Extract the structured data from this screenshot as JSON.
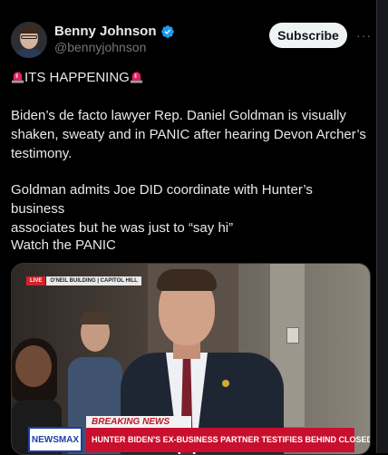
{
  "author": {
    "name": "Benny Johnson",
    "handle": "@bennyjohnson",
    "verified_color": "#1d9bf0"
  },
  "actions": {
    "subscribe_label": "Subscribe",
    "more_label": "···"
  },
  "post": {
    "headline": "ITS HAPPENING",
    "paragraph1_line1": "Biden’s de facto lawyer Rep. Daniel Goldman is visually",
    "paragraph1_line2": "shaken, sweaty and in PANIC after hearing Devon Archer’s",
    "paragraph1_line3": "testimony.",
    "paragraph2_line1": "Goldman admits Joe DID coordinate with Hunter’s business",
    "paragraph2_line2": "associates but he was just to “say hi”",
    "paragraph3": "Watch the PANIC"
  },
  "media": {
    "live_label": "LIVE",
    "location_label": "O'NEIL BUILDING | CAPITOL HILL",
    "breaking_label": "BREAKING NEWS",
    "channel_logo": "NEWSMAX",
    "chyron": "HUNTER BIDEN'S EX-BUSINESS PARTNER TESTIFIES BEHIND CLOSED DOORS"
  }
}
